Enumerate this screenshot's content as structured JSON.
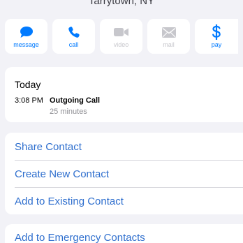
{
  "header": {
    "location": "Tarrytown, NY"
  },
  "actions": [
    {
      "label": "message",
      "icon": "message-bubble-icon",
      "enabled": true
    },
    {
      "label": "call",
      "icon": "phone-icon",
      "enabled": true
    },
    {
      "label": "video",
      "icon": "video-camera-icon",
      "enabled": false
    },
    {
      "label": "mail",
      "icon": "mail-envelope-icon",
      "enabled": false
    },
    {
      "label": "pay",
      "icon": "dollar-sign-icon",
      "enabled": true
    }
  ],
  "colors": {
    "accent": "#007aff",
    "disabled": "#c7c7cc",
    "link": "#2f6fce",
    "background": "#f2f2f7"
  },
  "history": {
    "day": "Today",
    "entries": [
      {
        "time": "3:08 PM",
        "type": "Outgoing Call",
        "duration": "25 minutes"
      }
    ]
  },
  "options": [
    {
      "label": "Share Contact"
    },
    {
      "label": "Create New Contact"
    },
    {
      "label": "Add to Existing Contact"
    }
  ],
  "emergency": {
    "label": "Add to Emergency Contacts"
  }
}
